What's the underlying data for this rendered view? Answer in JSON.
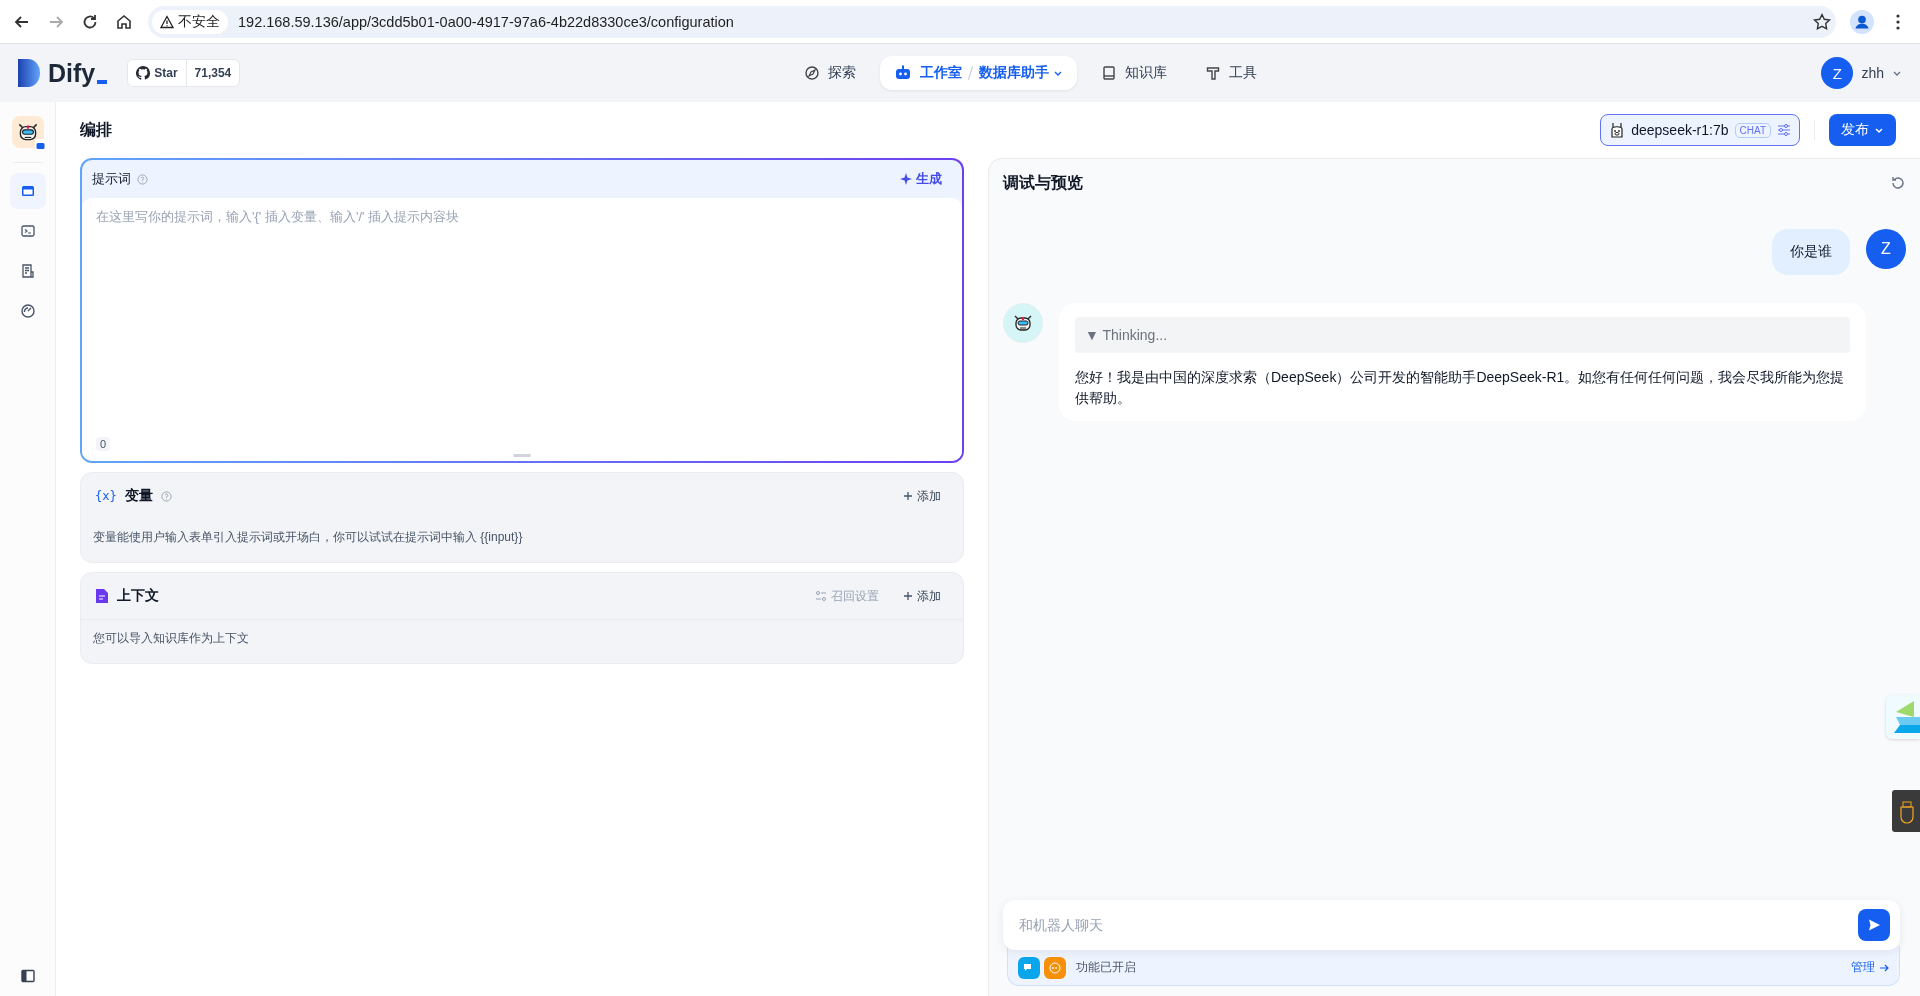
{
  "browser": {
    "security": "不安全",
    "url": "192.168.59.136/app/3cdd5b01-0a00-4917-97a6-4b22d8330ce3/configuration"
  },
  "header": {
    "logo": "Dify",
    "star_label": "Star",
    "star_count": "71,354",
    "nav": [
      {
        "label": "探索",
        "selected": false
      },
      {
        "label": "工作室",
        "selected": true
      },
      {
        "label": "知识库",
        "selected": false
      },
      {
        "label": "工具",
        "selected": false
      }
    ],
    "current_app": "数据库助手",
    "user": {
      "initial": "Z",
      "name": "zhh"
    }
  },
  "sidebar": {
    "items": [
      {
        "selected": true
      },
      {
        "selected": false
      },
      {
        "selected": false
      },
      {
        "selected": false
      }
    ]
  },
  "page_title": "编排",
  "model": {
    "name": "deepseek-r1:7b",
    "mode": "CHAT"
  },
  "publish": "发布",
  "prompt": {
    "title": "提示词",
    "generate": "生成",
    "placeholder": "在这里写你的提示词，输入'{' 插入变量、输入'/' 插入提示内容块",
    "count": "0"
  },
  "variables": {
    "icon": "{x}",
    "title": "变量",
    "add": "添加",
    "description": "变量能使用户输入表单引入提示词或开场白，你可以试试在提示词中输入 {{input}}"
  },
  "context": {
    "title": "上下文",
    "retrieval": "召回设置",
    "retrieval_disabled": true,
    "add": "添加",
    "description": "您可以导入知识库作为上下文"
  },
  "debug": {
    "title": "调试与预览",
    "messages": [
      {
        "kind": "user",
        "avatar": "Z",
        "text": "你是谁"
      },
      {
        "kind": "assistant",
        "thinking": "▼ Thinking...",
        "text": "您好！我是由中国的深度求索（DeepSeek）公司开发的智能助手DeepSeek-R1。如您有任何任何问题，我会尽我所能为您提供帮助。"
      }
    ],
    "input_placeholder": "和机器人聊天",
    "features": "功能已开启",
    "manage": "管理"
  }
}
